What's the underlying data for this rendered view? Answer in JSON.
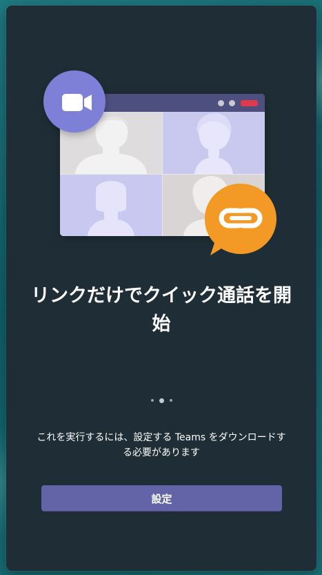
{
  "headline": "リンクだけでクイック通話を開始",
  "description": "これを実行するには、設定する Teams をダウンロードする必要があります",
  "pager": {
    "count": 3,
    "active_index": 1
  },
  "setup_button_label": "設定",
  "icons": {
    "video_badge": "video-camera-icon",
    "link_bubble": "link-icon"
  },
  "colors": {
    "panel_background": "#1f2e36",
    "button": "#6264a7",
    "video_badge": "#7e7fd6",
    "link_bubble": "#f39a26",
    "window_titlebar": "#4d4f7e",
    "close_control": "#e0384d"
  }
}
